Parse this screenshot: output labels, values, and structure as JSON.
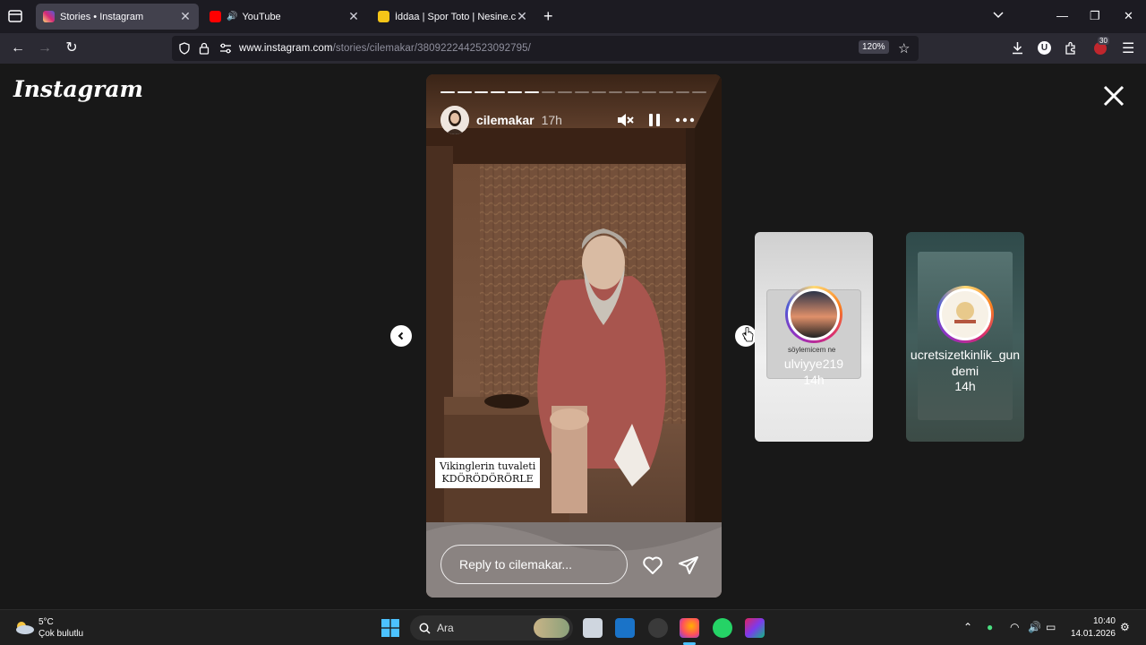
{
  "browser": {
    "tabs": [
      {
        "title": "Stories • Instagram",
        "active": true,
        "favicon_color": "#d62976"
      },
      {
        "title": "YouTube",
        "active": false,
        "favicon_color": "#ff0000"
      },
      {
        "title": "İddaa | Spor Toto | Nesine.com",
        "active": false,
        "favicon_color": "#f5c518"
      }
    ],
    "url_host": "www.instagram.com",
    "url_path": "/stories/cilemakar/3809222442523092795/",
    "zoom": "120%",
    "extension_badge": "30"
  },
  "page": {
    "logo": "Instagram",
    "story": {
      "username": "cilemakar",
      "time": "17h",
      "progress_total": 16,
      "progress_done": 6,
      "caption_line1": "Vikinglerin tuvaleti",
      "caption_line2": "KDÖRÖDÖRÖRLE",
      "reply_placeholder": "Reply to cilemakar..."
    },
    "next_stories": [
      {
        "name": "ulviyye219",
        "time": "14h",
        "overlay_text": "söylemicem ne"
      },
      {
        "name": "ucretsizetkinlik_gundemi",
        "name_line1": "ucretsizetkinlik_gun",
        "name_line2": "demi",
        "time": "14h"
      }
    ]
  },
  "taskbar": {
    "temperature": "5°C",
    "weather": "Çok bulutlu",
    "search_placeholder": "Ara",
    "time": "10:40",
    "date": "14.01.2026"
  }
}
